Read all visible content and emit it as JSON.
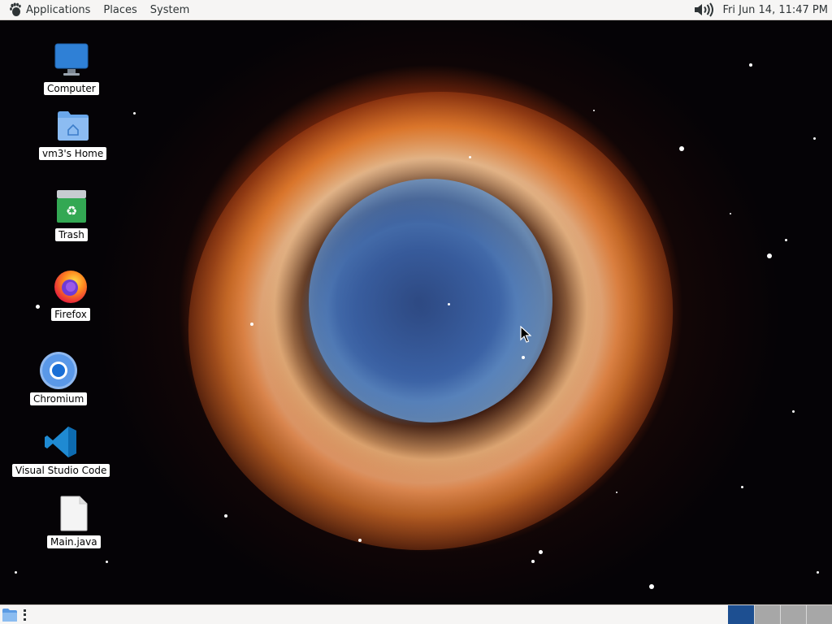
{
  "top_panel": {
    "menus": [
      "Applications",
      "Places",
      "System"
    ],
    "clock": "Fri Jun 14, 11:47 PM",
    "icons": [
      "gnome-foot-icon",
      "volume-icon"
    ]
  },
  "desktop": {
    "icons": [
      {
        "label": "Computer",
        "icon": "monitor-icon"
      },
      {
        "label": "vm3's Home",
        "icon": "home-folder-icon"
      },
      {
        "label": "Trash",
        "icon": "trash-icon"
      },
      {
        "label": "Firefox",
        "icon": "firefox-icon"
      },
      {
        "label": "Chromium",
        "icon": "chromium-icon"
      },
      {
        "label": "Visual Studio Code",
        "icon": "vscode-icon"
      },
      {
        "label": "Main.java",
        "icon": "file-icon"
      }
    ]
  },
  "bottom_panel": {
    "workspace_count": 4,
    "active_workspace": 1,
    "icons": [
      "show-desktop-icon",
      "panel-handle-icon"
    ]
  },
  "colors": {
    "panel_bg": "#f6f5f4",
    "workspace_active": "#1d4f91",
    "workspace_inactive": "#a7a7a7"
  }
}
